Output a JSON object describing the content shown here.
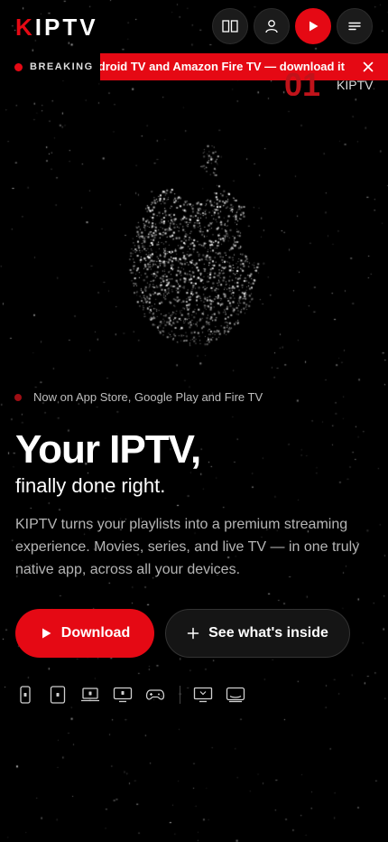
{
  "header": {
    "logo_text": "KIPTV",
    "buttons": [
      {
        "name": "compare-icon"
      },
      {
        "name": "user-icon"
      },
      {
        "name": "play-icon"
      },
      {
        "name": "menu-icon"
      }
    ]
  },
  "breaking": {
    "label": "BREAKING",
    "ticker": "ndroid TV and Amazon Fire TV — download it"
  },
  "slide": {
    "number": "01",
    "label": "KIPTV"
  },
  "hero": {
    "availability": "Now on App Store, Google Play and Fire TV",
    "title": "Your IPTV,",
    "subtitle": "finally done right.",
    "description": "KIPTV turns your playlists into a premium streaming experience. Movies, series, and live TV — in one truly native app, across all your devices.",
    "download_label": "Download",
    "inside_label": "See what's inside"
  },
  "platforms": [
    "phone-icon",
    "tablet-icon",
    "laptop-icon",
    "apple-tv-icon",
    "gamepad-icon",
    "android-tv-icon",
    "fire-tv-icon"
  ],
  "colors": {
    "accent": "#e50914",
    "background": "#000000"
  }
}
